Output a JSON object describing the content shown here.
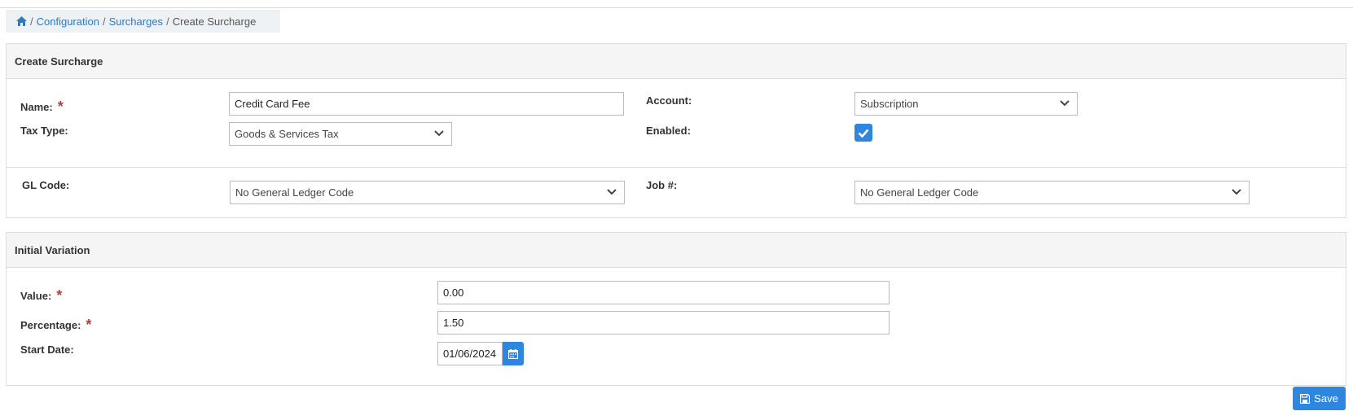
{
  "breadcrumb": {
    "home_icon": "home-icon",
    "sep": "/",
    "items": [
      "Configuration",
      "Surcharges"
    ],
    "current": "Create Surcharge"
  },
  "create_panel": {
    "title": "Create Surcharge",
    "name_label": "Name:",
    "name_value": "Credit Card Fee",
    "tax_type_label": "Tax Type:",
    "tax_type_value": "Goods & Services Tax",
    "account_label": "Account:",
    "account_value": "Subscription",
    "enabled_label": "Enabled:",
    "enabled_checked": true,
    "gl_code_label": "GL Code:",
    "gl_code_value": "No General Ledger Code",
    "job_label": "Job #:",
    "job_value": "No General Ledger Code",
    "required_marker": "*"
  },
  "variation_panel": {
    "title": "Initial Variation",
    "value_label": "Value:",
    "value_value": "0.00",
    "percentage_label": "Percentage:",
    "percentage_value": "1.50",
    "start_date_label": "Start Date:",
    "start_date_value": "01/06/2024",
    "calendar_icon": "calendar-icon"
  },
  "actions": {
    "save_label": "Save",
    "save_icon": "floppy-disk-icon"
  },
  "colors": {
    "link": "#337ab7",
    "primary": "#2e86de",
    "required": "#a94442"
  }
}
